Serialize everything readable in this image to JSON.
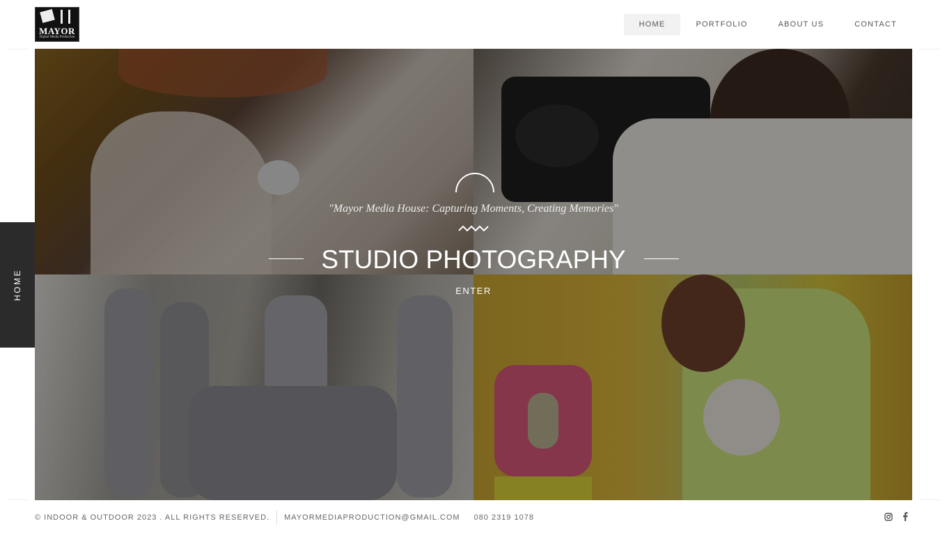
{
  "logo": {
    "brand": "MAYOR",
    "tagline": "Digital Media Production"
  },
  "nav": {
    "items": [
      {
        "label": "HOME",
        "active": true
      },
      {
        "label": "PORTFOLIO",
        "active": false
      },
      {
        "label": "ABOUT US",
        "active": false
      },
      {
        "label": "CONTACT",
        "active": false
      }
    ]
  },
  "hero": {
    "quote": "\"Mayor Media House: Capturing Moments, Creating Memories\"",
    "title": "STUDIO PHOTOGRAPHY",
    "enter_label": "ENTER"
  },
  "side_tab": {
    "label": "HOME"
  },
  "footer": {
    "copyright": "© INDOOR & OUTDOOR 2023 . ALL RIGHTS RESERVED.",
    "email": "MAYORMEDIAPRODUCTION@GMAIL.COM",
    "phone": "080 2319 1078"
  },
  "social": {
    "icons": [
      "instagram-icon",
      "facebook-icon"
    ]
  },
  "colors": {
    "side_tab_bg": "#2b2b2b",
    "active_nav_bg": "#f2f2f2"
  }
}
